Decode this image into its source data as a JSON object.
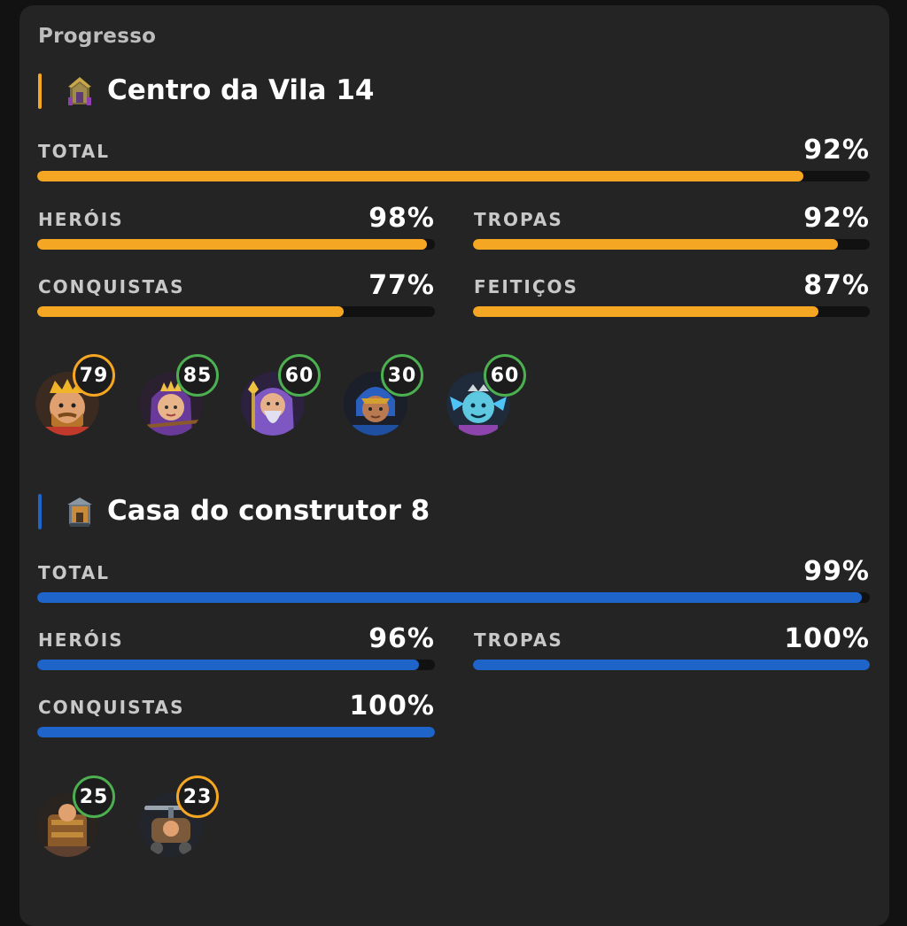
{
  "title": "Progresso",
  "colors": {
    "background": "#121212",
    "card": "#242424",
    "home_accent": "#f5a623",
    "builder_accent": "#1f64c8",
    "track": "#111111",
    "ring_green": "#4caf50",
    "ring_orange": "#f5a623"
  },
  "home": {
    "name": "Centro da Vila 14",
    "icon": "town-hall-icon",
    "total": {
      "label": "TOTAL",
      "value": "92%",
      "progress": 0.92
    },
    "heroes": {
      "label": "HERÓIS",
      "value": "98%",
      "progress": 0.98
    },
    "troops": {
      "label": "TROPAS",
      "value": "92%",
      "progress": 0.92
    },
    "achievements": {
      "label": "CONQUISTAS",
      "value": "77%",
      "progress": 0.77
    },
    "spells": {
      "label": "FEITIÇOS",
      "value": "87%",
      "progress": 0.87
    },
    "hero_levels": [
      {
        "icon": "barbarian-king-icon",
        "level": "79",
        "status": "partial"
      },
      {
        "icon": "archer-queen-icon",
        "level": "85",
        "status": "max"
      },
      {
        "icon": "grand-warden-icon",
        "level": "60",
        "status": "max"
      },
      {
        "icon": "royal-champion-icon",
        "level": "30",
        "status": "max"
      },
      {
        "icon": "minion-prince-icon",
        "level": "60",
        "status": "max"
      }
    ]
  },
  "builder": {
    "name": "Casa do construtor 8",
    "icon": "builder-hall-icon",
    "total": {
      "label": "TOTAL",
      "value": "99%",
      "progress": 0.99
    },
    "heroes": {
      "label": "HERÓIS",
      "value": "96%",
      "progress": 0.96
    },
    "troops": {
      "label": "TROPAS",
      "value": "100%",
      "progress": 1.0
    },
    "achievements": {
      "label": "CONQUISTAS",
      "value": "100%",
      "progress": 1.0
    },
    "hero_levels": [
      {
        "icon": "battle-machine-icon",
        "level": "25",
        "status": "max"
      },
      {
        "icon": "battle-copter-icon",
        "level": "23",
        "status": "partial"
      }
    ]
  }
}
